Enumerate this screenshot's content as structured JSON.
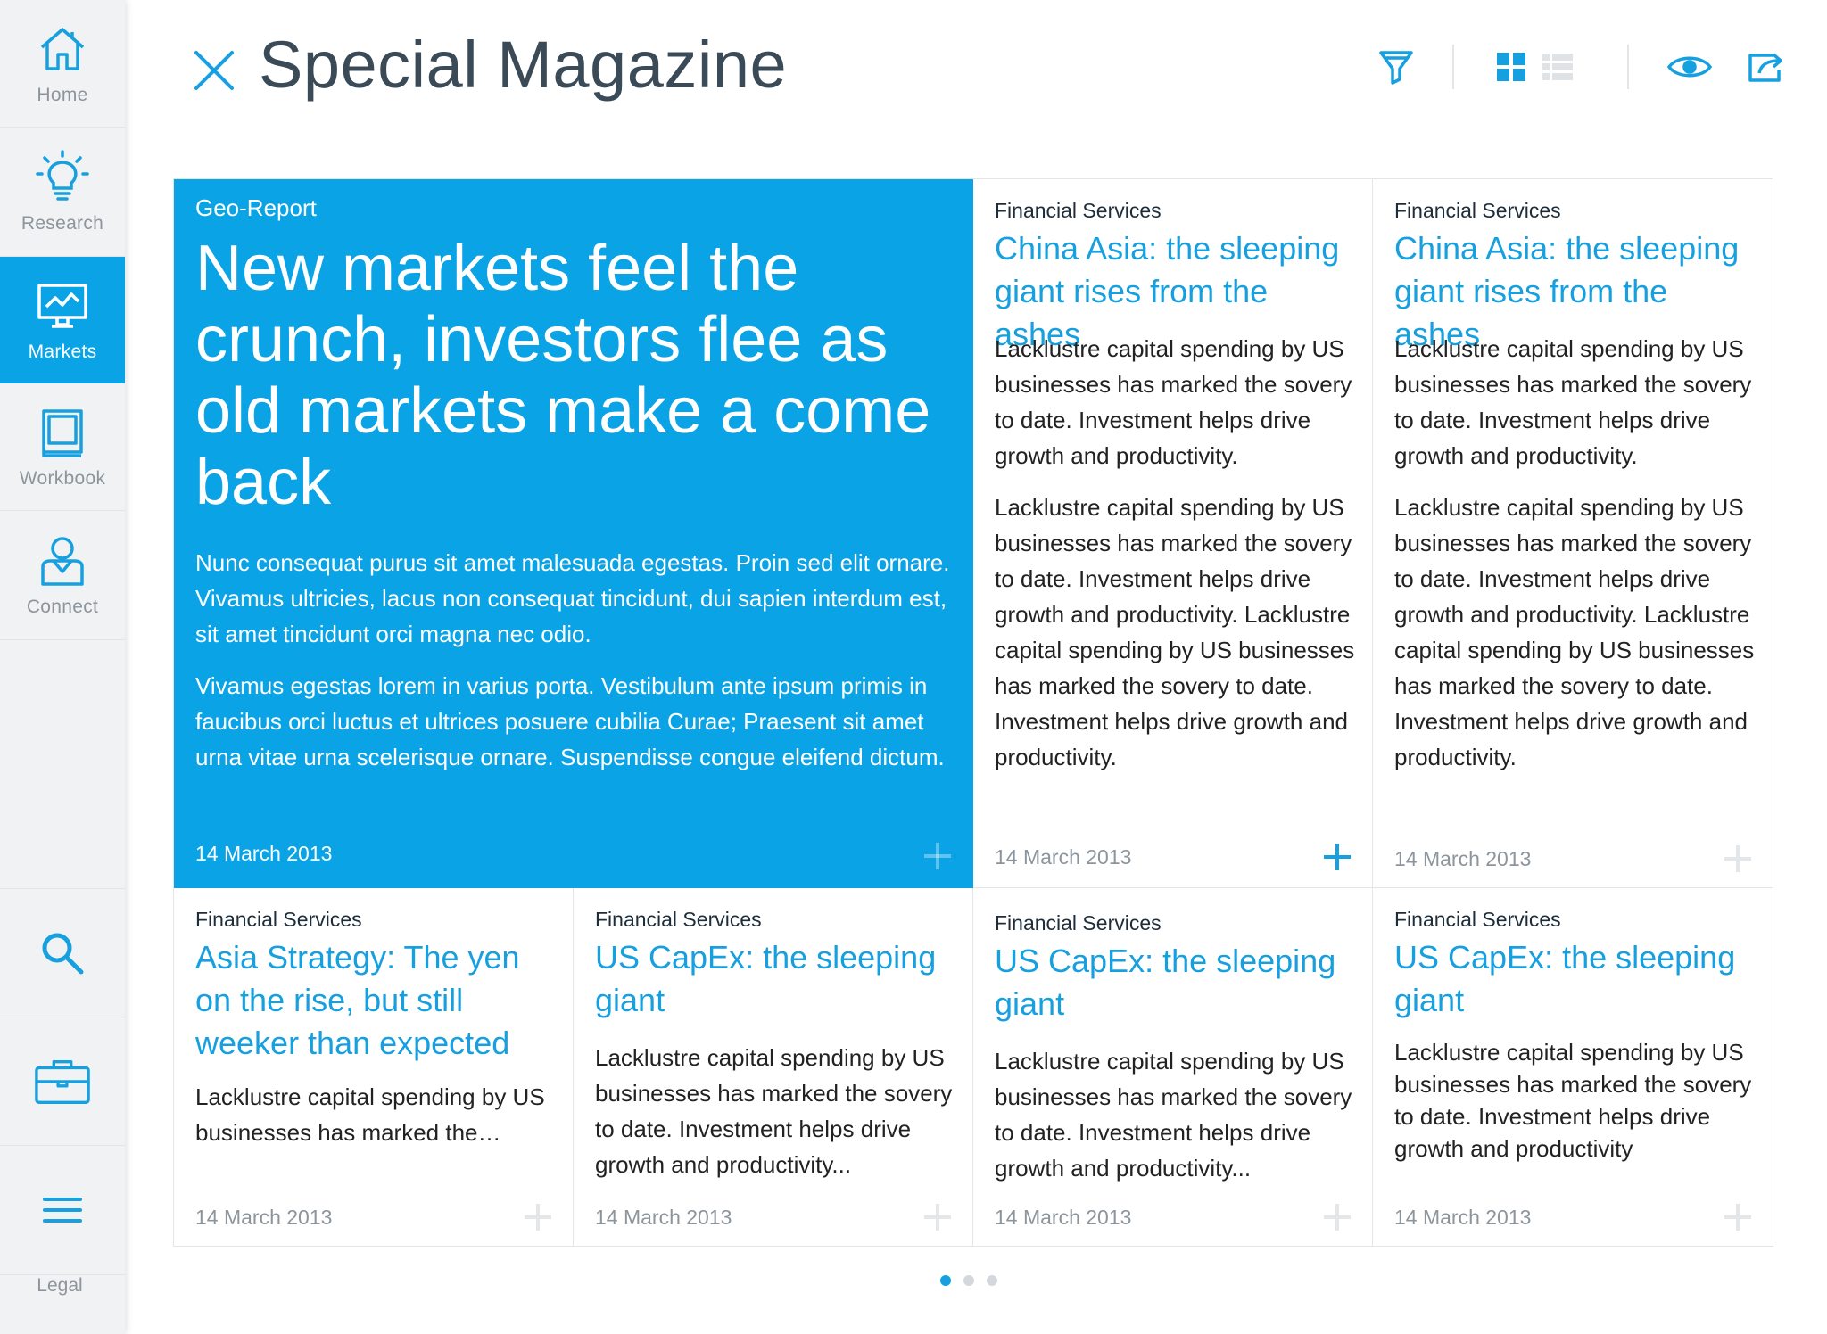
{
  "app": {
    "title": "Special Magazine"
  },
  "sidebar": {
    "items": [
      {
        "label": "Home",
        "icon": "home-icon",
        "active": false
      },
      {
        "label": "Research",
        "icon": "lightbulb-icon",
        "active": false
      },
      {
        "label": "Markets",
        "icon": "monitor-chart-icon",
        "active": true
      },
      {
        "label": "Workbook",
        "icon": "book-icon",
        "active": false
      },
      {
        "label": "Connect",
        "icon": "person-icon",
        "active": false
      }
    ],
    "tools": [
      {
        "icon": "search-icon"
      },
      {
        "icon": "briefcase-icon"
      },
      {
        "icon": "menu-icon"
      }
    ],
    "legal": "Legal"
  },
  "toolbar": {
    "icons": [
      "filter-icon",
      "grid-view-icon",
      "list-view-icon",
      "eye-icon",
      "share-icon"
    ]
  },
  "colors": {
    "accent": "#0aa3e6",
    "link": "#17a0df",
    "text": "#222222",
    "muted": "#8d959c"
  },
  "cards": {
    "feature": {
      "category": "Geo-Report",
      "title": "New markets feel the crunch, investors flee as old markets make a come back",
      "p1": "Nunc consequat purus sit amet malesuada egestas. Proin sed elit ornare. Vivamus ultricies, lacus non consequat tincidunt, dui sapien interdum est, sit amet tincidunt orci magna nec odio.",
      "p2": "Vivamus egestas lorem in varius porta. Vestibulum ante ipsum primis in faucibus orci luctus et ultrices posuere cubilia Curae; Praesent sit amet urna vitae urna scelerisque ornare. Suspendisse congue eleifend dictum.",
      "date": "14 March 2013"
    },
    "c2": {
      "category": "Financial Services",
      "title": "China Asia: the sleeping giant rises from the ashes",
      "p1": "Lacklustre capital spending by US businesses has marked the sovery to date. Investment helps drive growth and productivity.",
      "p2": "Lacklustre capital spending by US businesses has marked the sovery to date. Investment helps drive growth and productivity. Lacklustre capital spending by US businesses has marked the sovery to date. Investment helps drive growth and productivity.",
      "date": "14 March 2013"
    },
    "c3": {
      "category": "Financial Services",
      "title": "China Asia: the sleeping giant rises from the ashes",
      "p1": "Lacklustre capital spending by US businesses has marked the sovery to date. Investment helps drive growth and productivity.",
      "p2": "Lacklustre capital spending by US businesses has marked the sovery to date. Investment helps drive growth and productivity. Lacklustre capital spending by US businesses has marked the sovery to date. Investment helps drive growth and productivity.",
      "date": "14 March 2013"
    },
    "c4": {
      "category": "Financial Services",
      "title": "Asia Strategy: The yen on the rise, but still weeker than expected",
      "p1": "Lacklustre capital spending by US businesses has marked the…",
      "date": "14 March 2013"
    },
    "c5": {
      "category": "Financial Services",
      "title": "US CapEx: the sleeping giant",
      "p1": "Lacklustre capital spending by US businesses has marked the sovery to date. Investment helps drive growth and productivity...",
      "date": "14 March 2013"
    },
    "c6": {
      "category": "Financial Services",
      "title": "US CapEx: the sleeping giant",
      "p1": "Lacklustre capital spending by US businesses has marked the sovery to date. Investment helps drive growth and productivity...",
      "date": "14 March 2013"
    },
    "c7": {
      "category": "Financial Services",
      "title": "US CapEx: the sleeping giant",
      "p1": "Lacklustre capital spending by US businesses has marked the sovery to date. Investment helps drive growth and productivity",
      "date": "14 March 2013"
    }
  },
  "pager": {
    "pages": 3,
    "current": 1
  }
}
